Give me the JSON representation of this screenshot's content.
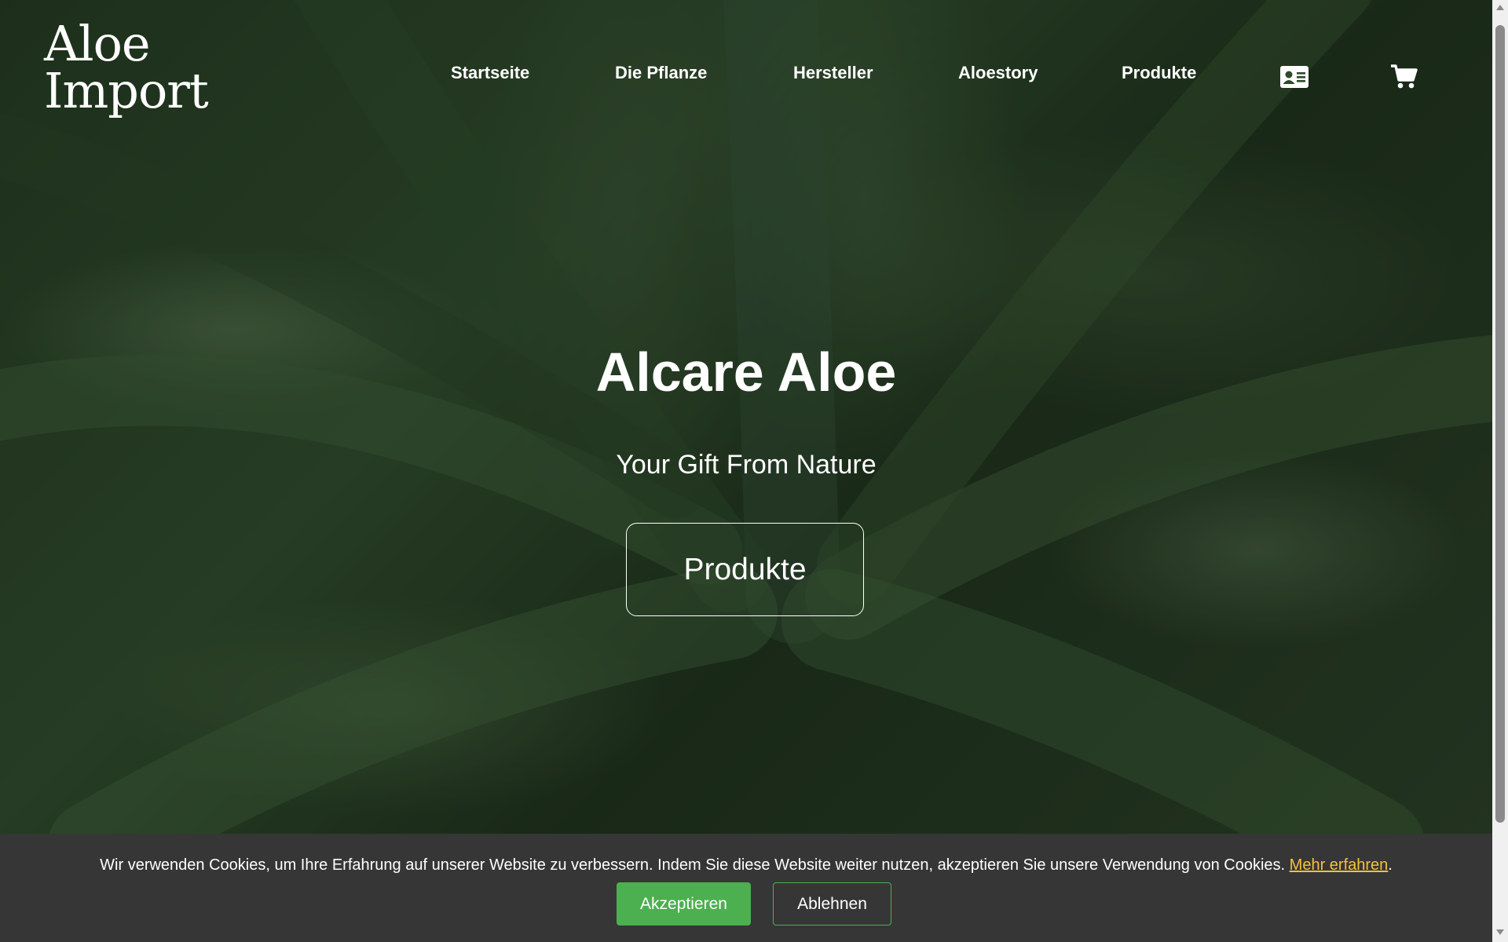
{
  "header": {
    "logo_line1": "Aloe",
    "logo_line2": "Import",
    "nav": [
      {
        "label": "Startseite"
      },
      {
        "label": "Die Pflanze"
      },
      {
        "label": "Hersteller"
      },
      {
        "label": "Aloestory"
      },
      {
        "label": "Produkte"
      }
    ],
    "icons": [
      "contact-card-icon",
      "shopping-cart-icon"
    ]
  },
  "hero": {
    "title": "Alcare Aloe",
    "subtitle": "Your Gift From Nature",
    "button_label": "Produkte"
  },
  "cookie_banner": {
    "text": "Wir verwenden Cookies, um Ihre Erfahrung auf unserer Website zu verbessern. Indem Sie diese Website weiter nutzen, akzeptieren Sie unsere Verwendung von Cookies.",
    "link_label": "Mehr erfahren",
    "trailing": ".",
    "accept_label": "Akzeptieren",
    "decline_label": "Ablehnen"
  },
  "colors": {
    "accent_green": "#4caf50",
    "link_yellow": "#f3c33a",
    "cookie_bg": "#363636"
  }
}
